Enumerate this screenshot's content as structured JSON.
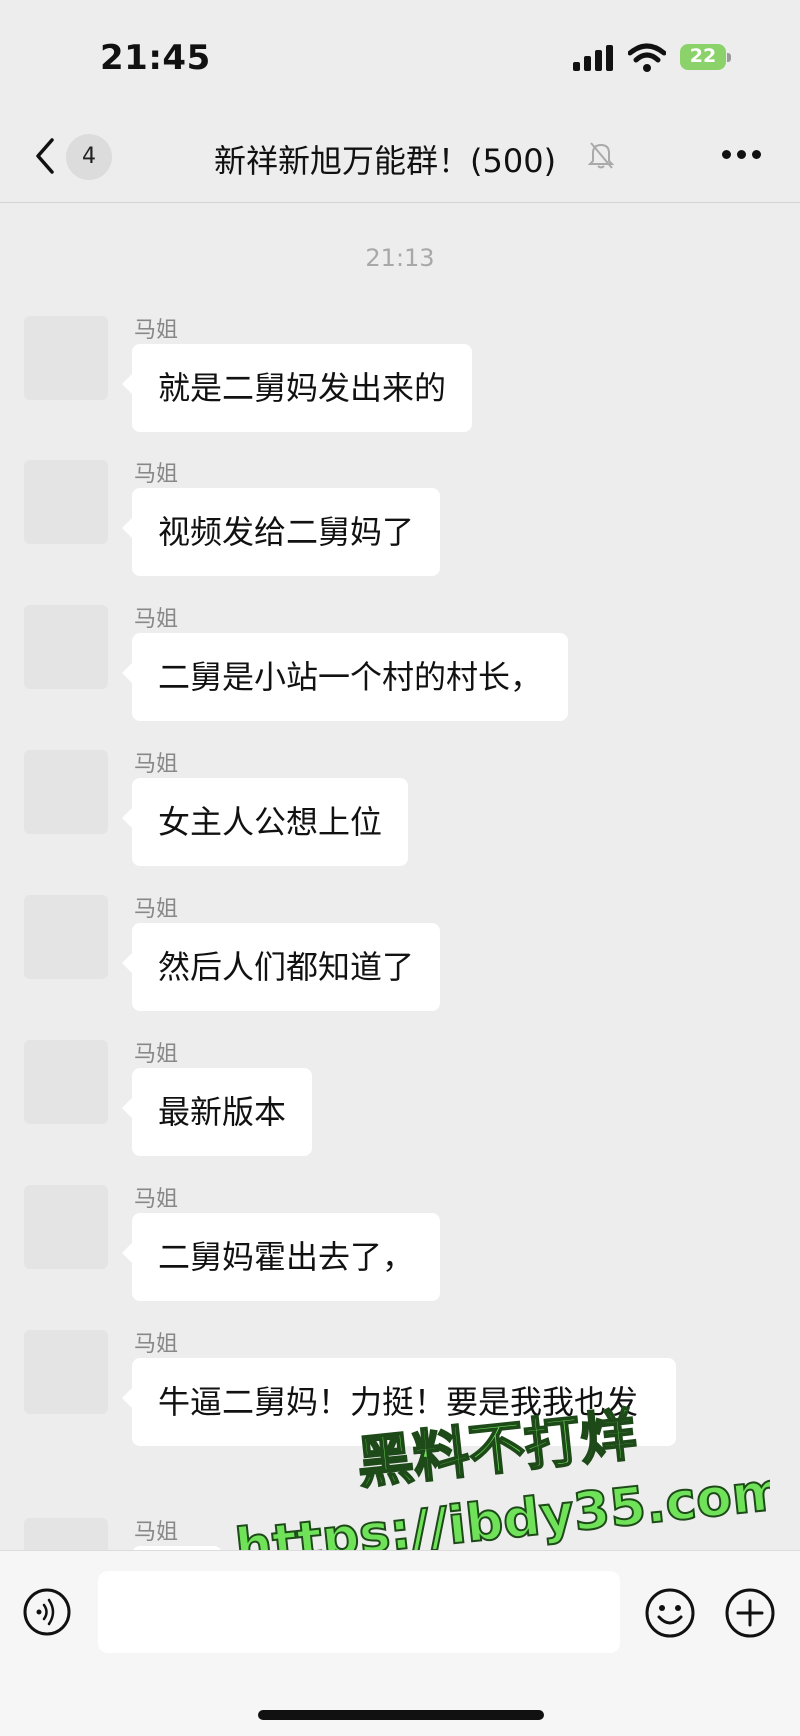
{
  "status_bar": {
    "time": "21:45",
    "battery": "22"
  },
  "header": {
    "unread_count": "4",
    "title": "新祥新旭万能群！(500)"
  },
  "timestamp": "21:13",
  "messages": [
    {
      "sender": "马姐",
      "text": "就是二舅妈发出来的"
    },
    {
      "sender": "马姐",
      "text": "视频发给二舅妈了"
    },
    {
      "sender": "马姐",
      "text": "二舅是小站一个村的村长，"
    },
    {
      "sender": "马姐",
      "text": "女主人公想上位"
    },
    {
      "sender": "马姐",
      "text": "然后人们都知道了"
    },
    {
      "sender": "马姐",
      "text": "最新版本"
    },
    {
      "sender": "马姐",
      "text": "二舅妈霍出去了，"
    },
    {
      "sender": "马姐",
      "text": "牛逼二舅妈！力挺！要是我我也发"
    },
    {
      "sender": "马姐",
      "text": ""
    }
  ],
  "watermark": {
    "line1": "黑料不打烊",
    "line2": "https://ibdy35.com"
  },
  "colors": {
    "background": "#ededed",
    "bubble": "#ffffff",
    "battery": "#8bd26a",
    "watermark": "#6fe25a"
  }
}
